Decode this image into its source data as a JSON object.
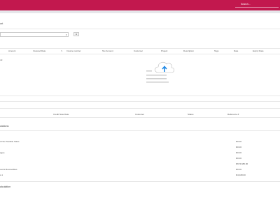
{
  "topbar": {
    "search_placeholder": "Search..."
  },
  "report": {
    "title_partial": "ort",
    "select_value": ""
  },
  "upload_table": {
    "columns": [
      "Amount",
      "Invoiced Date",
      "Invoice number",
      "Tax Amount",
      "Customer",
      "Project",
      "Description",
      "Tags",
      "Date",
      "Expiry Date"
    ],
    "empty_label": "nd"
  },
  "invoices_table": {
    "columns": [
      "Credit Note Date",
      "Customer",
      "Status",
      "Reference #"
    ]
  },
  "calculations": {
    "title": "ulations",
    "rows": [
      {
        "label": "",
        "value": ""
      },
      {
        "label": "d Non Taxable Sales",
        "value": "R0.00"
      },
      {
        "label": "",
        "value": "R0.00"
      },
      {
        "label": "ages",
        "value": "R0.00"
      },
      {
        "label": "",
        "value": "R0.00"
      },
      {
        "label": "",
        "value": "R674,680.00"
      },
      {
        "label": "ounts Receivables",
        "value": "R0.00"
      },
      {
        "label": "s.1",
        "value": "R4,028.00"
      }
    ]
  },
  "footer_section": {
    "title": "alculation"
  },
  "colors": {
    "brand": "#c2184e",
    "upload": "#1e88e5"
  }
}
